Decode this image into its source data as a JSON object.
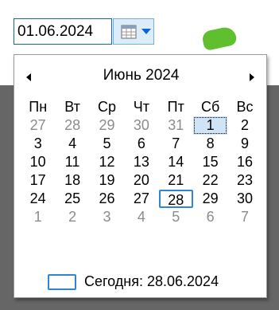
{
  "date_field": {
    "value": "01.06.2024"
  },
  "calendar": {
    "month_title": "Июнь 2024",
    "weekdays": [
      "Пн",
      "Вт",
      "Ср",
      "Чт",
      "Пт",
      "Сб",
      "Вс"
    ],
    "weeks": [
      [
        "27",
        "28",
        "29",
        "30",
        "31",
        "1",
        "2"
      ],
      [
        "3",
        "4",
        "5",
        "6",
        "7",
        "8",
        "9"
      ],
      [
        "10",
        "11",
        "12",
        "13",
        "14",
        "15",
        "16"
      ],
      [
        "17",
        "18",
        "19",
        "20",
        "21",
        "22",
        "23"
      ],
      [
        "24",
        "25",
        "26",
        "27",
        "28",
        "29",
        "30"
      ],
      [
        "1",
        "2",
        "3",
        "4",
        "5",
        "6",
        "7"
      ]
    ],
    "muted": [
      [
        true,
        true,
        true,
        true,
        true,
        false,
        false
      ],
      [
        false,
        false,
        false,
        false,
        false,
        false,
        false
      ],
      [
        false,
        false,
        false,
        false,
        false,
        false,
        false
      ],
      [
        false,
        false,
        false,
        false,
        false,
        false,
        false
      ],
      [
        false,
        false,
        false,
        false,
        false,
        false,
        false
      ],
      [
        true,
        true,
        true,
        true,
        true,
        true,
        true
      ]
    ],
    "selected_day": "1",
    "today_day": "28",
    "today_label": "Сегодня: 28.06.2024"
  },
  "icons": {
    "calendar": "calendar-icon",
    "dropdown": "chevron-down-icon",
    "prev": "chevron-left-icon",
    "next": "chevron-right-icon"
  },
  "colors": {
    "accent": "#0a64d6",
    "today_border": "#2f86d4",
    "selected_bg": "#cfe4f7",
    "muted_text": "#8c8c8c"
  }
}
